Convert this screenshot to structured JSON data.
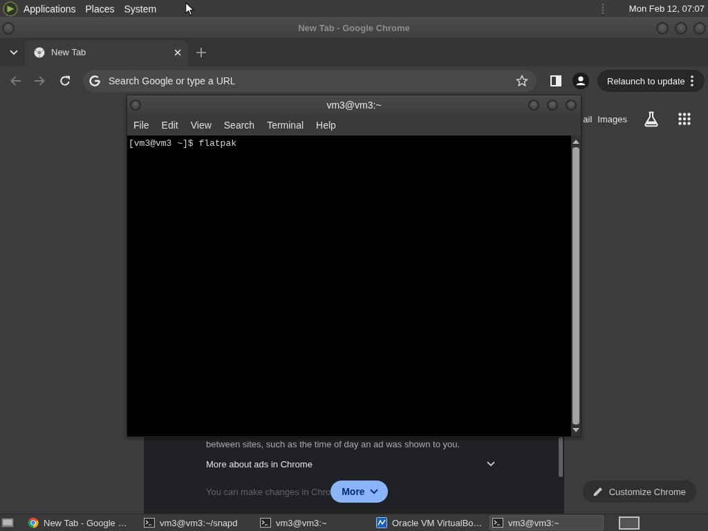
{
  "top_panel": {
    "menus": [
      "Applications",
      "Places",
      "System"
    ],
    "clock": "Mon Feb 12, 07:07"
  },
  "browser": {
    "title": "New Tab - Google Chrome",
    "tabs": [
      {
        "title": "New Tab",
        "selected": true
      }
    ],
    "nav_buttons": [
      {
        "kind": "back",
        "disabled": true
      },
      {
        "kind": "forward",
        "disabled": true
      },
      {
        "kind": "reload",
        "disabled": false
      }
    ],
    "omnibox": {
      "placeholder": "Search Google or type a URL"
    },
    "relaunch_button": "Relaunch to update",
    "header_links": [
      "ail",
      "Images"
    ],
    "dialog": {
      "text": "between sites, such as the time of day an ad was shown to you.",
      "expander": {
        "label": "More about ads in Chrome",
        "expanded": false
      },
      "note": "You can make changes in Chro",
      "more_button": "More"
    },
    "customize_button": "Customize Chrome"
  },
  "terminal": {
    "title": "vm3@vm3:~",
    "menus": [
      "File",
      "Edit",
      "View",
      "Search",
      "Terminal",
      "Help"
    ],
    "lines": [
      "[vm3@vm3 ~]$ flatpak"
    ]
  },
  "taskbar": {
    "items": [
      {
        "label": "New Tab - Google …",
        "kind": "browser",
        "selected": false
      },
      {
        "label": "vm3@vm3:~/snapd",
        "kind": "terminal",
        "selected": false
      },
      {
        "label": "vm3@vm3:~",
        "kind": "terminal",
        "selected": false
      },
      {
        "label": "Oracle VM VirtualBo…",
        "kind": "virtualbox",
        "selected": false
      },
      {
        "label": "vm3@vm3:~",
        "kind": "terminal",
        "selected": true
      }
    ]
  }
}
